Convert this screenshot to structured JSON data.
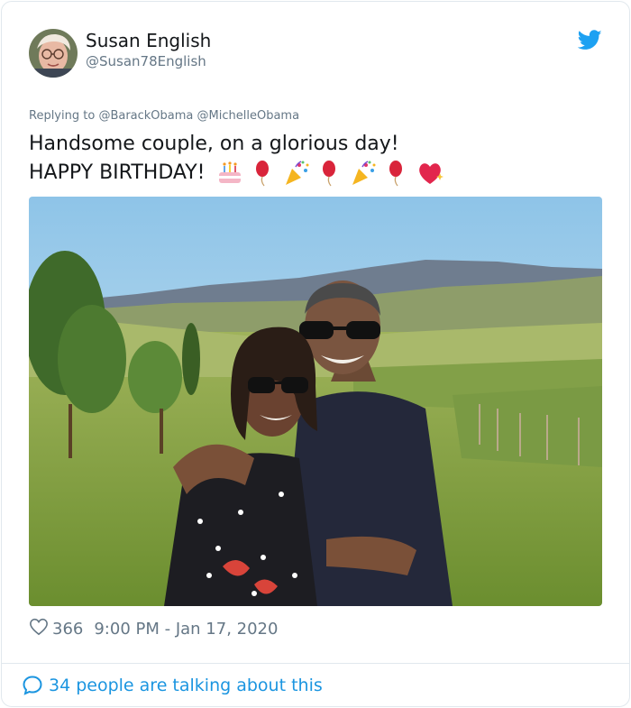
{
  "tweet": {
    "author_name": "Susan English",
    "author_handle": "@Susan78English",
    "reply_prefix": "Replying to",
    "reply_mentions": [
      "@BarackObama",
      "@MichelleObama"
    ],
    "text_line1": "Handsome couple, on a glorious day!",
    "text_line2": "HAPPY BIRTHDAY!",
    "emoji_sequence": [
      "birthday-cake-icon",
      "balloon-icon",
      "party-popper-icon",
      "balloon-icon",
      "party-popper-icon",
      "balloon-icon",
      "sparkling-heart-icon"
    ],
    "likes": "366",
    "timestamp": "9:00 PM - Jan 17, 2020",
    "conversation": "34 people are talking about this"
  },
  "colors": {
    "brand_blue": "#1da1f2",
    "link_blue": "#1b95e0",
    "muted_gray": "#657786",
    "text_dark": "#14171a",
    "border": "#e1e8ed"
  }
}
